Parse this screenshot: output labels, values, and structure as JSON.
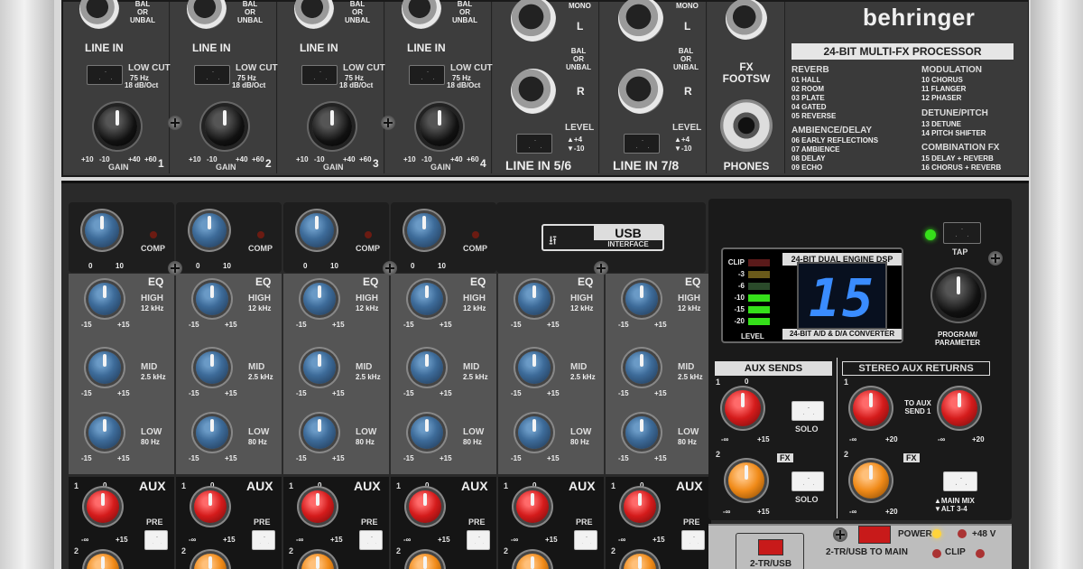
{
  "brand": "behringer",
  "fx_title": "24-BIT MULTI-FX PROCESSOR",
  "channels": [
    {
      "line_in": "LINE IN",
      "low_cut": "LOW CUT",
      "low_cut_freq": "75 Hz",
      "low_cut_slope": "18 dB/Oct",
      "gain": "GAIN",
      "gain_ticks": [
        "+10",
        "-10",
        "+40",
        "+60"
      ],
      "num": "1",
      "bal": "BAL\nOR\nUNBAL"
    },
    {
      "line_in": "LINE IN",
      "low_cut": "LOW CUT",
      "low_cut_freq": "75 Hz",
      "low_cut_slope": "18 dB/Oct",
      "gain": "GAIN",
      "gain_ticks": [
        "+10",
        "-10",
        "+40",
        "+60"
      ],
      "num": "2",
      "bal": "BAL\nOR\nUNBAL"
    },
    {
      "line_in": "LINE IN",
      "low_cut": "LOW CUT",
      "low_cut_freq": "75 Hz",
      "low_cut_slope": "18 dB/Oct",
      "gain": "GAIN",
      "gain_ticks": [
        "+10",
        "-10",
        "+40",
        "+60"
      ],
      "num": "3",
      "bal": "BAL\nOR\nUNBAL"
    },
    {
      "line_in": "LINE IN",
      "low_cut": "LOW CUT",
      "low_cut_freq": "75 Hz",
      "low_cut_slope": "18 dB/Oct",
      "gain": "GAIN",
      "gain_ticks": [
        "+10",
        "-10",
        "+40",
        "+60"
      ],
      "num": "4",
      "bal": "BAL\nOR\nUNBAL"
    }
  ],
  "stereo": [
    {
      "mono": "MONO",
      "l": "L",
      "bal": "BAL\nOR\nUNBAL",
      "r": "R",
      "level": "LEVEL",
      "lvl_up": "▲+4",
      "lvl_dn": "▼-10",
      "name": "LINE IN 5/6"
    },
    {
      "mono": "MONO",
      "l": "L",
      "bal": "BAL\nOR\nUNBAL",
      "r": "R",
      "level": "LEVEL",
      "lvl_up": "▲+4",
      "lvl_dn": "▼-10",
      "name": "LINE IN 7/8"
    }
  ],
  "fx_footsw": "FX\nFOOTSW",
  "phones": "PHONES",
  "effects": {
    "reverb_head": "REVERB",
    "reverb": [
      "01 HALL",
      "02 ROOM",
      "03 PLATE",
      "04 GATED",
      "05 REVERSE"
    ],
    "amb_head": "AMBIENCE/DELAY",
    "amb": [
      "06 EARLY REFLECTIONS",
      "07 AMBIENCE",
      "08 DELAY",
      "09 ECHO"
    ],
    "mod_head": "MODULATION",
    "mod": [
      "10 CHORUS",
      "11 FLANGER",
      "12 PHASER"
    ],
    "det_head": "DETUNE/PITCH",
    "det": [
      "13 DETUNE",
      "14 PITCH SHIFTER"
    ],
    "comb_head": "COMBINATION FX",
    "comb": [
      "15 DELAY + REVERB",
      "16 CHORUS + REVERB"
    ]
  },
  "comp": {
    "label": "COMP",
    "min": "0",
    "max": "10"
  },
  "usb": {
    "big": "USB",
    "small": "INTERFACE"
  },
  "eq": {
    "title": "EQ",
    "bands": [
      {
        "name": "HIGH",
        "freq": "12 kHz"
      },
      {
        "name": "MID",
        "freq": "2.5 kHz"
      },
      {
        "name": "LOW",
        "freq": "80 Hz"
      }
    ],
    "min": "-15",
    "max": "+15"
  },
  "aux": {
    "title": "AUX",
    "one": "1",
    "two": "2",
    "zero": "0",
    "min": "-∞",
    "max": "+15",
    "pre": "PRE"
  },
  "dsp": {
    "title": "24-BIT DUAL ENGINE DSP",
    "sub": "24-BIT A/D & D/A CONVERTER",
    "display": "15",
    "meter": [
      "CLIP",
      "-3",
      "-6",
      "-10",
      "-15",
      "-20"
    ],
    "meter_label": "LEVEL",
    "tap": "TAP",
    "program": "PROGRAM/\nPARAMETER"
  },
  "aux_sends": {
    "title": "AUX SENDS",
    "one": "1",
    "two": "2",
    "fx": "FX",
    "solo": "SOLO",
    "min": "-∞",
    "max": "+15",
    "zero": "0"
  },
  "stereo_aux": {
    "title": "STEREO AUX RETURNS",
    "one": "1",
    "two": "2",
    "fx": "FX",
    "to_aux": "TO AUX\nSEND 1",
    "mainmix": "▲MAIN MIX\n▼ALT 3-4",
    "min": "-∞",
    "max": "+20"
  },
  "bottom": {
    "power": "POWER",
    "phantom": "+48 V",
    "tr_main": "2-TR/USB TO MAIN",
    "clip": "CLIP",
    "tr_usb": "2-TR/USB"
  }
}
